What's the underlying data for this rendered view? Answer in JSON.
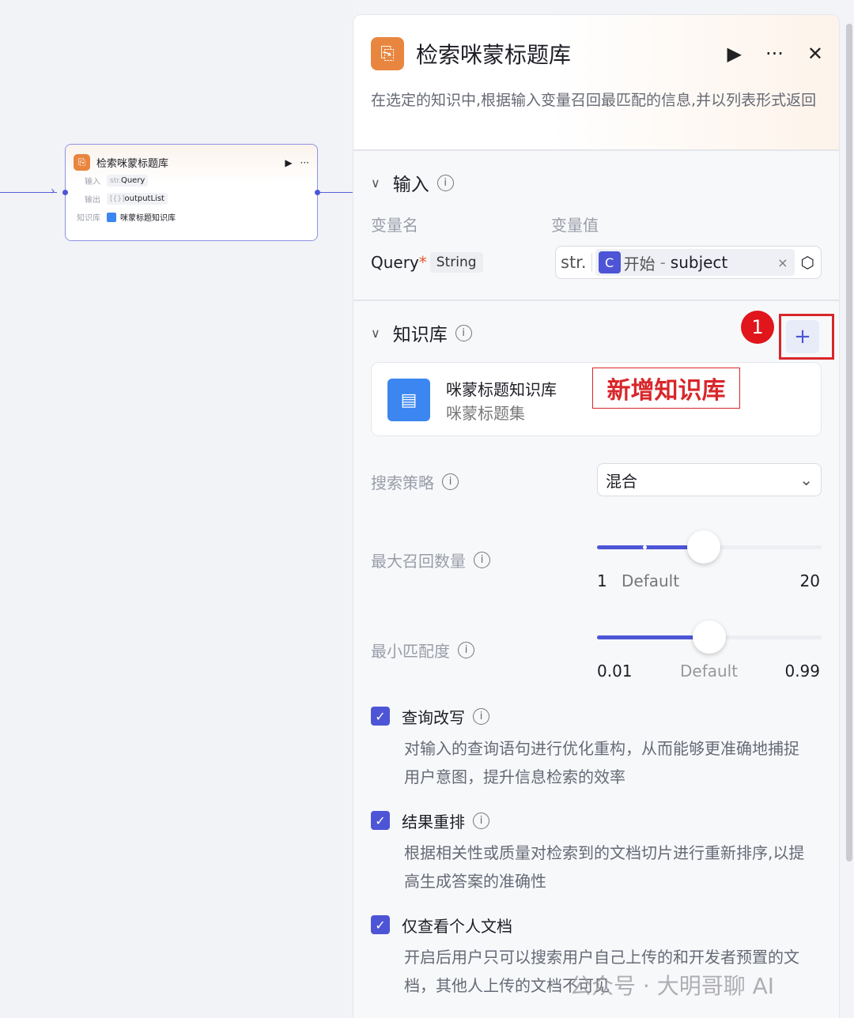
{
  "node": {
    "title": "检索咪蒙标题库",
    "input_label": "输入",
    "input_type": "str.",
    "input_value": "Query",
    "output_label": "输出",
    "output_type": "[{}]",
    "output_value": "outputList",
    "kb_label": "知识库",
    "kb_value": "咪蒙标题知识库"
  },
  "panel": {
    "title": "检索咪蒙标题库",
    "description": "在选定的知识中,根据输入变量召回最匹配的信息,并以列表形式返回",
    "input_section": {
      "title": "输入",
      "col_name": "变量名",
      "col_value": "变量值",
      "var_name": "Query",
      "required": "*",
      "var_type": "String",
      "value_prefix": "str.",
      "value_source": "开始",
      "value_sep": "-",
      "value_field": "subject",
      "clear": "×"
    },
    "kb_section": {
      "title": "知识库",
      "add": "+",
      "kb_name": "咪蒙标题知识库",
      "kb_sub": "咪蒙标题集"
    },
    "annotation": {
      "badge": "1",
      "label": "新增知识库"
    },
    "search_strategy": {
      "label": "搜索策略",
      "value": "混合"
    },
    "max_recall": {
      "label": "最大召回数量",
      "min": "1",
      "default": "Default",
      "max": "20",
      "value": 10
    },
    "min_match": {
      "label": "最小匹配度",
      "min": "0.01",
      "default": "Default",
      "max": "0.99",
      "value": 0.5
    },
    "options": [
      {
        "label": "查询改写",
        "checked": true,
        "desc": "对输入的查询语句进行优化重构，从而能够更准确地捕捉用户意图，提升信息检索的效率"
      },
      {
        "label": "结果重排",
        "checked": true,
        "desc": "根据相关性或质量对检索到的文档切片进行重新排序,以提高生成答案的准确性"
      },
      {
        "label": "仅查看个人文档",
        "checked": true,
        "desc": "开启后用户只可以搜索用户自己上传的和开发者预置的文档，其他人上传的文档不可见"
      }
    ]
  },
  "watermark": "公众号 · 大明哥聊 AI",
  "colors": {
    "accent": "#4d55d6",
    "node_icon": "#e8863f",
    "annotation": "#d8262a"
  }
}
